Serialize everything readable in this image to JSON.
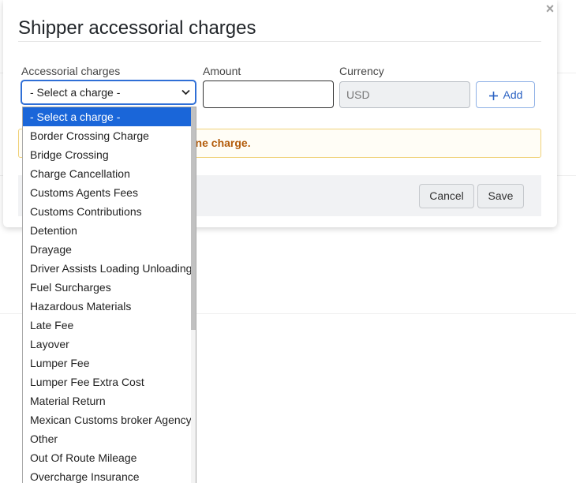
{
  "modal": {
    "title": "Shipper accessorial charges",
    "close_symbol": "×"
  },
  "form": {
    "charges_label": "Accessorial charges",
    "amount_label": "Amount",
    "currency_label": "Currency",
    "select_value": "- Select a charge -",
    "amount_value": "",
    "currency_value": "USD",
    "add_label": "Add"
  },
  "warning": {
    "visible_text": "one charge."
  },
  "footer": {
    "cancel_label": "Cancel",
    "save_label": "Save"
  },
  "dropdown": {
    "items": [
      "- Select a charge -",
      "Border Crossing Charge",
      "Bridge Crossing",
      "Charge Cancellation",
      "Customs Agents Fees",
      "Customs Contributions",
      "Detention",
      "Drayage",
      "Driver Assists Loading Unloading",
      "Fuel Surcharges",
      "Hazardous Materials",
      "Late Fee",
      "Layover",
      "Lumper Fee",
      "Lumper Fee Extra Cost",
      "Material Return",
      "Mexican Customs broker Agency",
      "Other",
      "Out Of Route Mileage",
      "Overcharge Insurance"
    ],
    "selected_index": 0
  },
  "colors": {
    "accent": "#1a66d9",
    "warning_text": "#b35c0b",
    "warning_border": "#f0d27a"
  },
  "icons": {
    "close": "close-icon",
    "add": "plus-icon",
    "select": "chevron-down-icon"
  }
}
